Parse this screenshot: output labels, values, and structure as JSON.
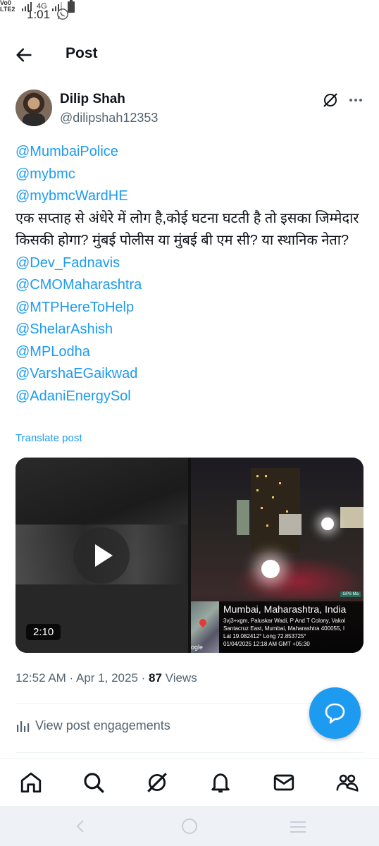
{
  "status_bar": {
    "time": "1:01",
    "network": "Vo0 LTE2",
    "network_type": "4G"
  },
  "header": {
    "title": "Post"
  },
  "author": {
    "name": "Dilip Shah",
    "handle": "@dilipshah12353"
  },
  "post": {
    "lines": [
      {
        "text": "@MumbaiPolice",
        "kind": "mention"
      },
      {
        "text": "@mybmc",
        "kind": "mention"
      },
      {
        "text": "@mybmcWardHE",
        "kind": "mention"
      },
      {
        "text": "एक सप्ताह से अंधेरे में लोग है,कोई घटना घटती है तो इसका जिम्मेदार किसकी होगा? मुंबई पोलीस या मुंबई बी एम सी? या स्थानिक नेता?",
        "kind": "text"
      },
      {
        "text": "@Dev_Fadnavis",
        "kind": "mention"
      },
      {
        "text": "@CMOMaharashtra",
        "kind": "mention"
      },
      {
        "text": "@MTPHereToHelp",
        "kind": "mention"
      },
      {
        "text": "@ShelarAshish",
        "kind": "mention"
      },
      {
        "text": "@MPLodha",
        "kind": "mention"
      },
      {
        "text": "@VarshaEGaikwad",
        "kind": "mention"
      },
      {
        "text": "@AdaniEnergySol",
        "kind": "mention"
      }
    ],
    "translate_label": "Translate post"
  },
  "media": {
    "video_duration": "2:10",
    "photo_overlay": {
      "logo": "GPS Ma",
      "map_brand": "ogle",
      "city": "Mumbai, Maharashtra, India",
      "address1": "3vj3+xgm, Paluskar Wadi, P And T Colony, Vakol",
      "address2": "Santacruz East, Mumbai, Maharashtra 400055, I",
      "coords": "Lat 19.082412° Long 72.853725°",
      "datetime": "01/04/2025 12:18 AM GMT +05:30"
    }
  },
  "meta": {
    "time": "12:52 AM",
    "date": "Apr 1, 2025",
    "views_count": "87",
    "views_label": "Views"
  },
  "engagements": {
    "label": "View post engagements"
  },
  "bottom_nav": [
    "home-icon",
    "search-icon",
    "grok-icon",
    "notifications-icon",
    "messages-icon",
    "communities-icon"
  ],
  "colors": {
    "accent": "#1d9bf0",
    "text": "#0f1419",
    "secondary": "#536471"
  }
}
